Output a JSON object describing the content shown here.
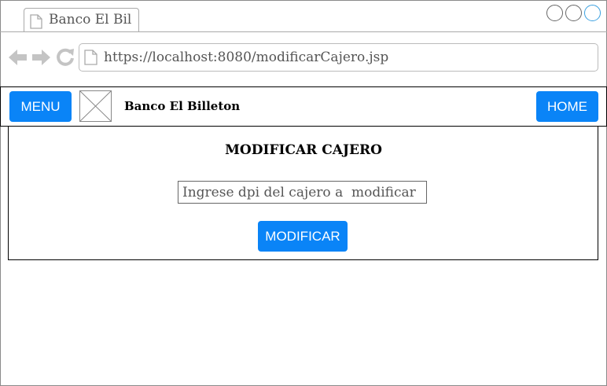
{
  "browser": {
    "tab_title": "Banco El Bil",
    "url": "https://localhost:8080/modificarCajero.jsp"
  },
  "appbar": {
    "menu_label": "MENU",
    "brand": "Banco El Billeton",
    "home_label": "HOME"
  },
  "form": {
    "title": "MODIFICAR CAJERO",
    "dpi_placeholder": "Ingrese dpi del cajero a  modificar",
    "submit_label": "MODIFICAR"
  },
  "colors": {
    "button_bg": "#0a84f7",
    "active_window_control": "#3aa0e0"
  },
  "icons": [
    "document-icon",
    "back-arrow-icon",
    "forward-arrow-icon",
    "reload-icon",
    "image-placeholder-icon"
  ]
}
